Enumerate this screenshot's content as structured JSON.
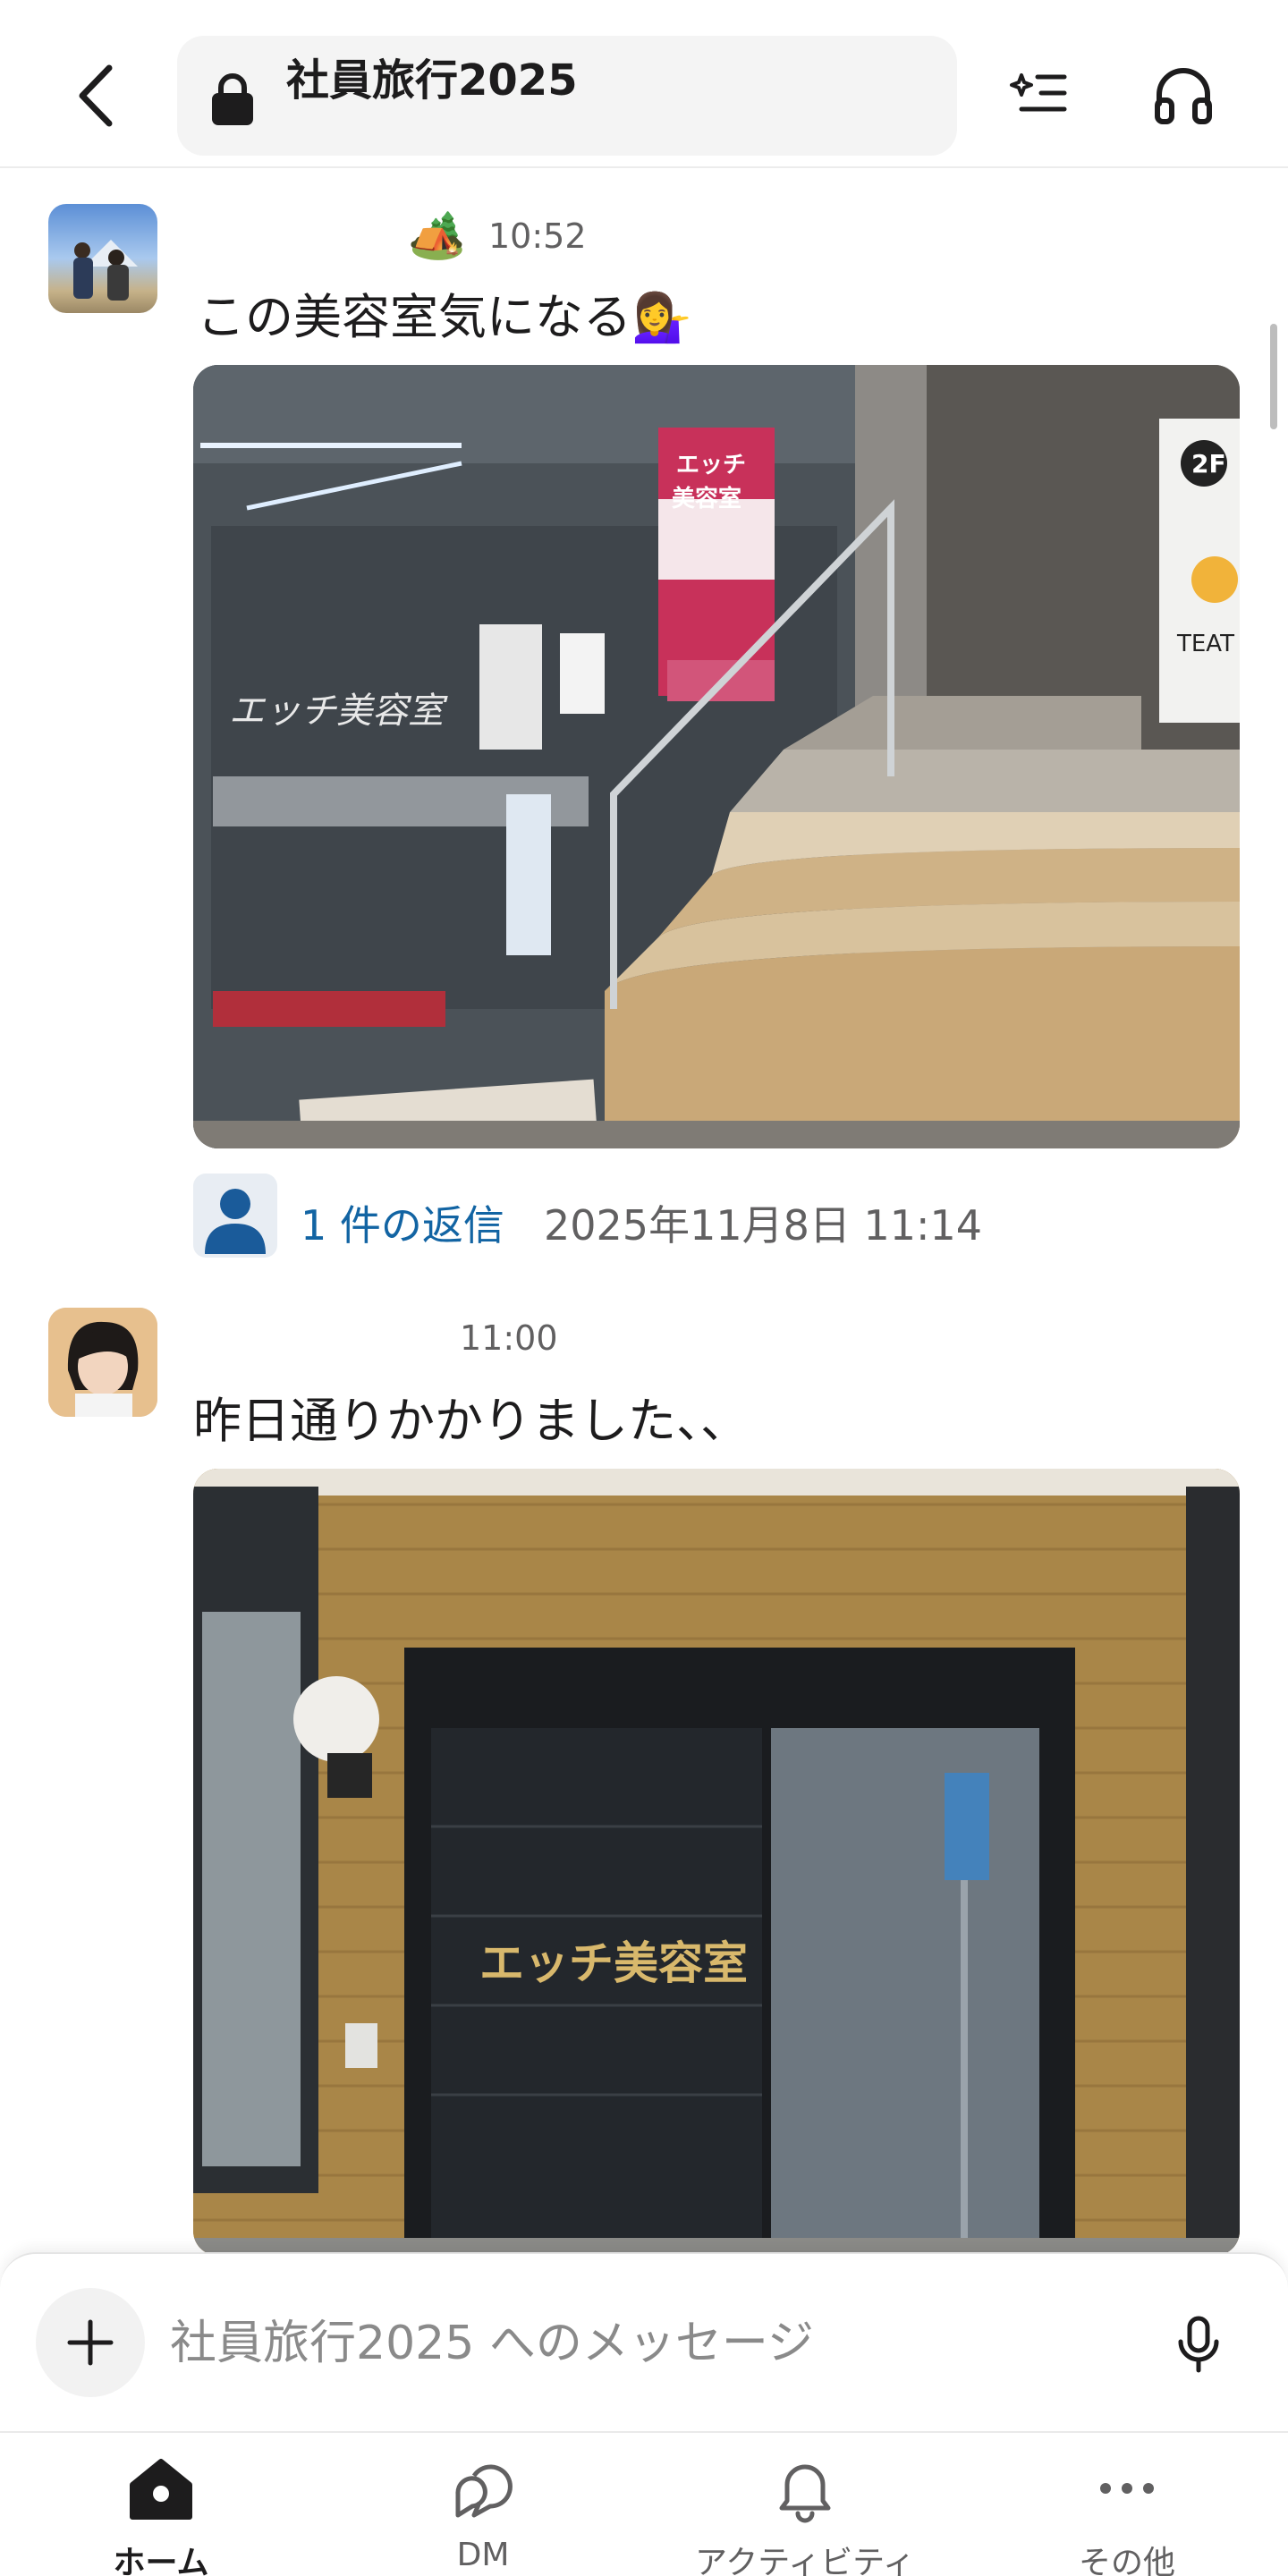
{
  "header": {
    "channel_name": "社員旅行2025",
    "back_icon": "chevron-left-icon",
    "lock_icon": "lock-icon",
    "summary_icon": "ai-summary-icon",
    "huddle_icon": "headphones-icon"
  },
  "messages": [
    {
      "status_emoji": "🏕️",
      "time": "10:52",
      "text": "この美容室気になる",
      "text_emoji": "💁‍♀️",
      "photo_description_signage": "エッチ美容室",
      "replies": {
        "count_label": "1 件の返信",
        "last_reply": "2025年11月8日 11:14"
      }
    },
    {
      "time": "11:00",
      "text": "昨日通りかかりました、、",
      "photo_description_signage": "エッチ美容室"
    }
  ],
  "composer": {
    "placeholder": "社員旅行2025 へのメッセージ"
  },
  "nav": {
    "items": [
      {
        "label": "ホーム",
        "icon": "home-icon",
        "active": true
      },
      {
        "label": "DM",
        "icon": "dm-icon",
        "active": false
      },
      {
        "label": "アクティビティ",
        "icon": "bell-icon",
        "active": false
      },
      {
        "label": "その他",
        "icon": "more-icon",
        "active": false
      }
    ]
  },
  "colors": {
    "link": "#1264a3",
    "text": "#1d1c1d",
    "muted": "#616061"
  }
}
